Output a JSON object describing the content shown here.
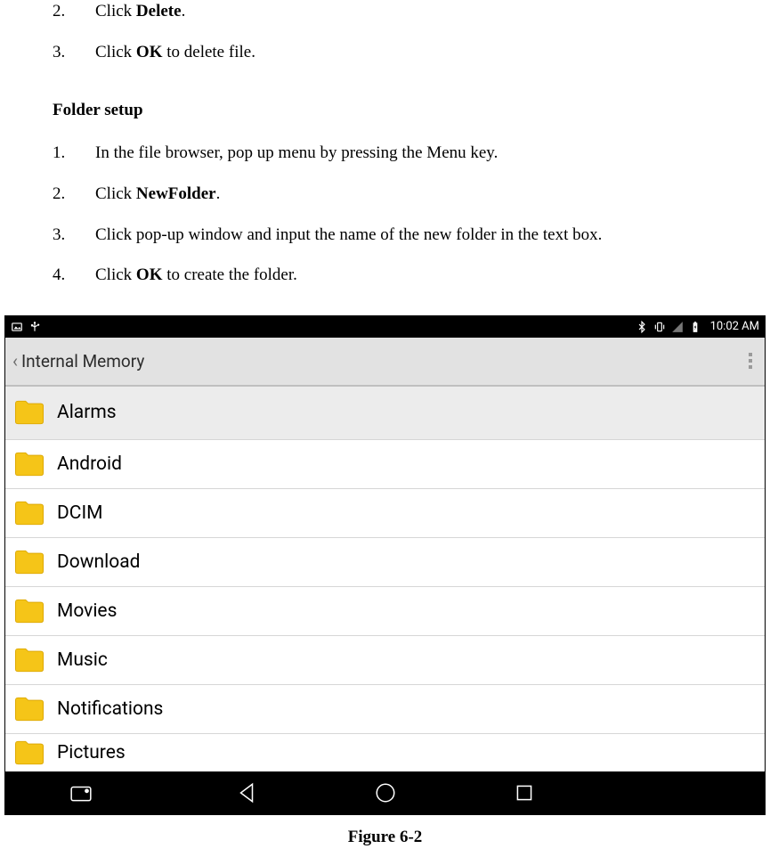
{
  "doc": {
    "delete_steps": [
      {
        "n": "2.",
        "pre": "Click ",
        "bold": "Delete",
        "post": "."
      },
      {
        "n": "3.",
        "pre": "Click ",
        "bold": "OK",
        "post": " to delete file."
      }
    ],
    "heading": "Folder setup",
    "folder_steps": [
      {
        "n": "1.",
        "pre": "In the file browser, pop up menu by pressing the Menu key.",
        "bold": "",
        "post": ""
      },
      {
        "n": "2.",
        "pre": "Click ",
        "bold": "NewFolder",
        "post": "."
      },
      {
        "n": "3.",
        "pre": "Click pop-up window and input the name of the new folder in the text box.",
        "bold": "",
        "post": ""
      },
      {
        "n": "4.",
        "pre": "Click ",
        "bold": "OK",
        "post": " to create the folder."
      }
    ],
    "caption": "Figure 6-2"
  },
  "shot": {
    "status_time": "10:02 AM",
    "title": "Internal Memory",
    "folders": [
      "Alarms",
      "Android",
      "DCIM",
      "Download",
      "Movies",
      "Music",
      "Notifications",
      "Pictures"
    ]
  }
}
